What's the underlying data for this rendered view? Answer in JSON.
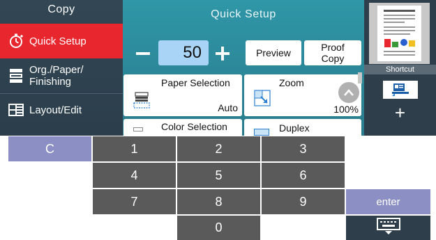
{
  "sidebar": {
    "title": "Copy",
    "items": [
      {
        "label": "Quick Setup",
        "icon": "stopwatch-icon"
      },
      {
        "label": "Org./Paper/\nFinishing",
        "icon": "document-stack-icon"
      },
      {
        "label": "Layout/Edit",
        "icon": "layout-grid-icon"
      }
    ]
  },
  "main": {
    "title": "Quick Setup",
    "copies_value": "50",
    "preview_label": "Preview",
    "proof_copy_label": "Proof\nCopy",
    "cards": [
      {
        "title": "Paper Selection",
        "value": "Auto",
        "icon": "paper-tray-icon"
      },
      {
        "title": "Zoom",
        "value": "100%",
        "icon": "zoom-icon"
      },
      {
        "title": "Color Selection",
        "value": "",
        "icon": "color-icon"
      },
      {
        "title": "Duplex",
        "value": "",
        "icon": "duplex-icon"
      }
    ]
  },
  "right_panel": {
    "shortcut_label": "Shortcut",
    "add_symbol": "+"
  },
  "keypad": {
    "clear_label": "C",
    "keys": [
      "1",
      "2",
      "3",
      "4",
      "5",
      "6",
      "7",
      "8",
      "9",
      "0"
    ],
    "enter_label": "enter"
  },
  "colors": {
    "sidebar_bg": "#2f4350",
    "active_item": "#e8262e",
    "main_accent": "#2c8798",
    "keypad_bg": "#5a5a5a",
    "clear_enter_bg": "#8b8fc4",
    "copies_box": "#a9d4f5"
  }
}
